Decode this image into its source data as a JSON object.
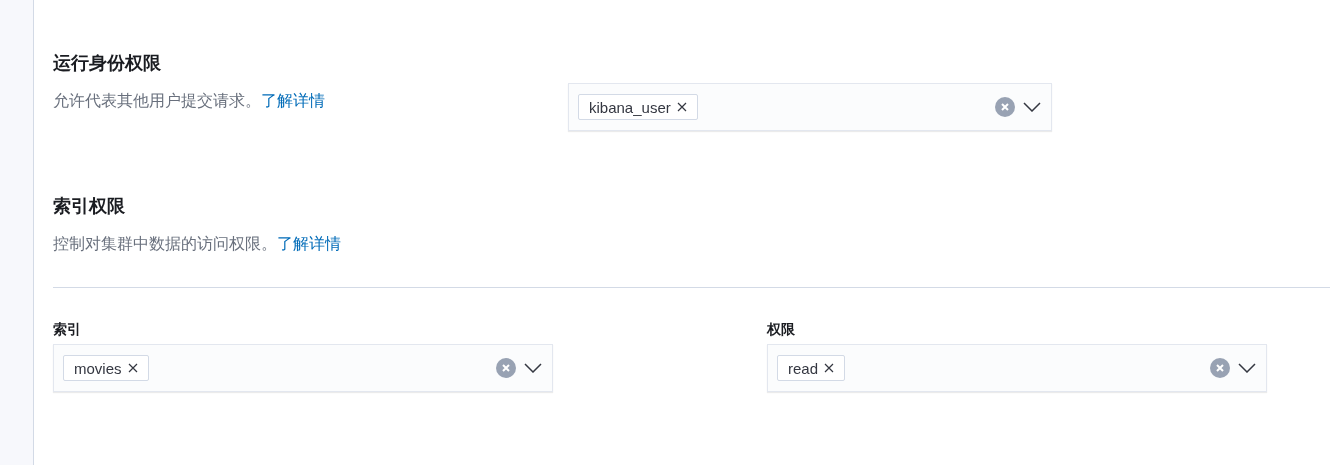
{
  "run_as": {
    "title": "运行身份权限",
    "description": "允许代表其他用户提交请求。",
    "link": "了解详情",
    "tags": [
      {
        "label": "kibana_user"
      }
    ]
  },
  "index_privileges": {
    "title": "索引权限",
    "description": "控制对集群中数据的访问权限。",
    "link": "了解详情",
    "fields": [
      {
        "label": "索引",
        "tags": [
          {
            "label": "movies"
          }
        ]
      },
      {
        "label": "权限",
        "tags": [
          {
            "label": "read"
          }
        ]
      }
    ]
  }
}
